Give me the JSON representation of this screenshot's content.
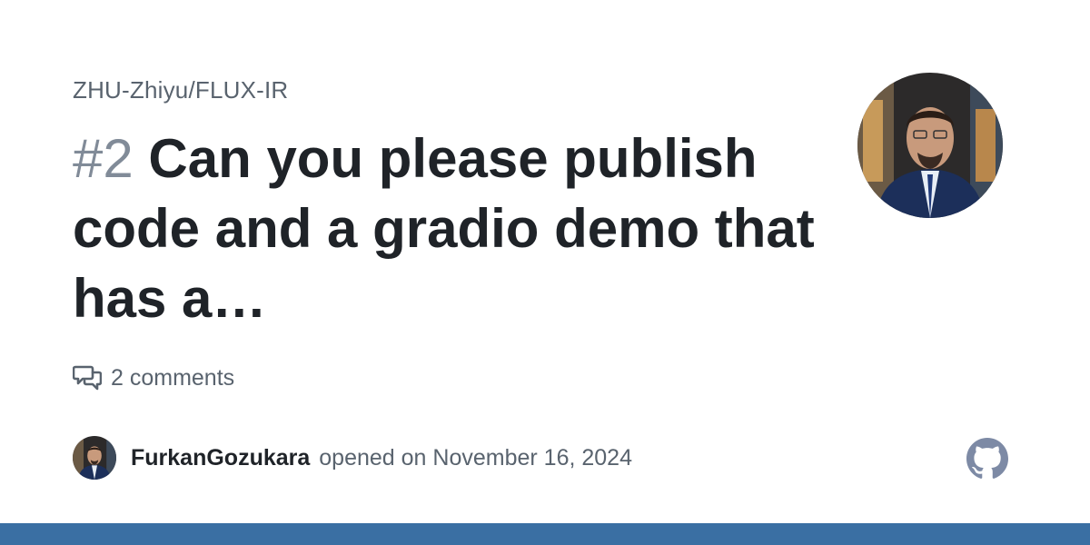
{
  "repository": "ZHU-Zhiyu/FLUX-IR",
  "issue": {
    "number": "#2",
    "title": "Can you please publish code and a gradio demo that has a…"
  },
  "comments_label": "2 comments",
  "opened_by": {
    "author": "FurkanGozukara",
    "action_text": "opened on November 16, 2024"
  },
  "icons": {
    "comments": "comment-discussion-icon",
    "brand": "github-icon"
  },
  "colors": {
    "title": "#1f2328",
    "muted": "#59636e",
    "number": "#818b98",
    "bar": "#3a6fa3",
    "github_logo": "#7d8aa5"
  }
}
